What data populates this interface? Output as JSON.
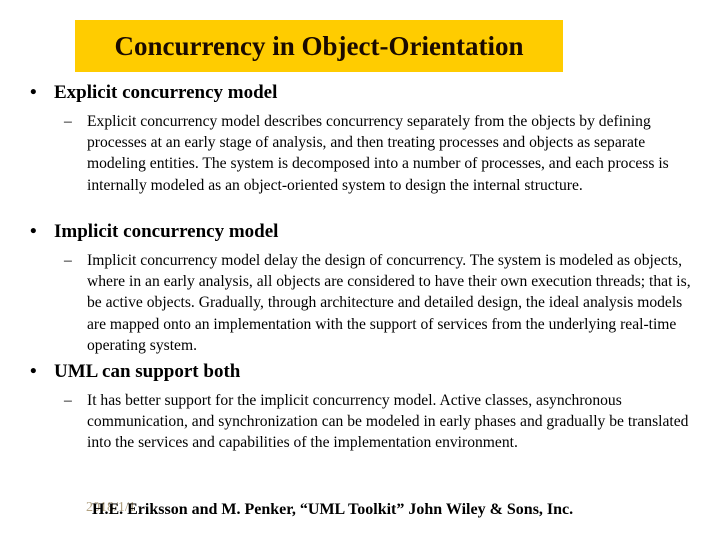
{
  "slide": {
    "title": "Concurrency in Object-Orientation",
    "title_band_color": "#ffcc00",
    "bullets": [
      {
        "label": "Explicit concurrency model",
        "subitems": [
          "Explicit concurrency model describes concurrency separately from the objects by defining processes at an early stage of analysis, and then treating processes and objects as separate modeling entities. The system is decomposed into a number of processes, and each process is internally modeled as an object-oriented system to design the internal structure."
        ]
      },
      {
        "label": "Implicit concurrency model",
        "subitems": [
          "Implicit concurrency model delay the design of concurrency. The system is modeled as objects, where in an early analysis, all objects are considered to have their own execution threads; that is, be active objects. Gradually, through architecture and detailed design, the ideal analysis models are mapped onto an implementation with the support of services from the underlying real-time operating system."
        ]
      },
      {
        "label": "UML can support both",
        "subitems": [
          "It has better support for the implicit concurrency model. Active classes, asynchronous communication, and synchronization can be modeled in early phases and gradually be translated into the services and capabilities of the implementation environment."
        ]
      }
    ],
    "bullet_glyph": "•",
    "dash_glyph": "–",
    "footer": {
      "date": "2018/1/1",
      "citation": "H.E. Eriksson and M. Penker, “UML Toolkit” John Wiley & Sons, Inc."
    }
  }
}
